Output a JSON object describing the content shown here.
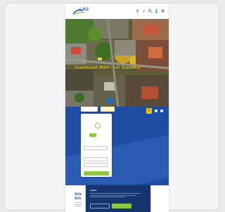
{
  "brand": {
    "logo_text": "LAG",
    "accent_blue": "#1e4ea3",
    "accent_yellow": "#f3d100",
    "accent_green": "#8dc63f"
  },
  "header": {
    "icons": [
      "accessibility-icon",
      "edit-icon",
      "search-icon",
      "user-icon",
      "menu-icon"
    ]
  },
  "hero": {
    "title": "Stadtkasel 2024 - mit Stadtfest"
  },
  "blue_section": {
    "tabs": [
      "",
      ""
    ],
    "control_label": "×"
  },
  "form": {
    "fields": [
      "",
      "",
      ""
    ],
    "submit_label": ""
  },
  "lower": {
    "title": "Sele Sch"
  },
  "cookie_banner": {
    "title": "Cookies",
    "buttons": [
      "",
      "",
      ""
    ]
  }
}
